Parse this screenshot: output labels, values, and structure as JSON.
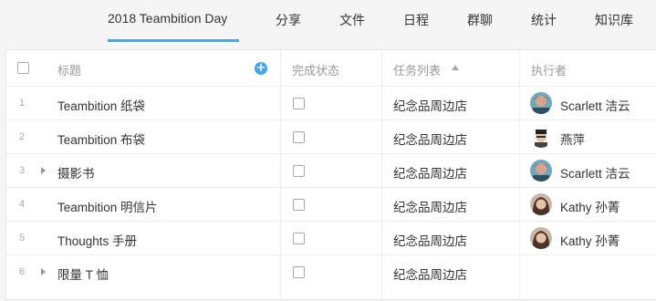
{
  "nav": {
    "tabs": [
      {
        "label": "2018 Teambition Day",
        "active": true
      },
      {
        "label": "分享"
      },
      {
        "label": "文件"
      },
      {
        "label": "日程"
      },
      {
        "label": "群聊"
      },
      {
        "label": "统计"
      },
      {
        "label": "知识库"
      }
    ],
    "accent_color": "#3da8f5"
  },
  "table": {
    "headers": {
      "title": "标题",
      "status": "完成状态",
      "tasklist": "任务列表",
      "assignee": "执行者"
    },
    "rows": [
      {
        "num": "1",
        "title": "Teambition 纸袋",
        "expandable": false,
        "done": false,
        "tasklist": "纪念品周边店",
        "assignee": "Scarlett 洁云",
        "avatar": "scarlett-avatar"
      },
      {
        "num": "2",
        "title": "Teambition 布袋",
        "expandable": false,
        "done": false,
        "tasklist": "纪念品周边店",
        "assignee": "燕萍",
        "avatar": "yanping-avatar"
      },
      {
        "num": "3",
        "title": "摄影书",
        "expandable": true,
        "done": false,
        "tasklist": "纪念品周边店",
        "assignee": "Scarlett 洁云",
        "avatar": "scarlett-avatar"
      },
      {
        "num": "4",
        "title": "Teambition 明信片",
        "expandable": false,
        "done": false,
        "tasklist": "纪念品周边店",
        "assignee": "Kathy 孙菁",
        "avatar": "kathy-avatar"
      },
      {
        "num": "5",
        "title": "Thoughts 手册",
        "expandable": false,
        "done": false,
        "tasklist": "纪念品周边店",
        "assignee": "Kathy 孙菁",
        "avatar": "kathy-avatar"
      },
      {
        "num": "6",
        "title": "限量 T 恤",
        "expandable": true,
        "done": false,
        "tasklist": "纪念品周边店",
        "assignee": "",
        "avatar": ""
      }
    ]
  }
}
